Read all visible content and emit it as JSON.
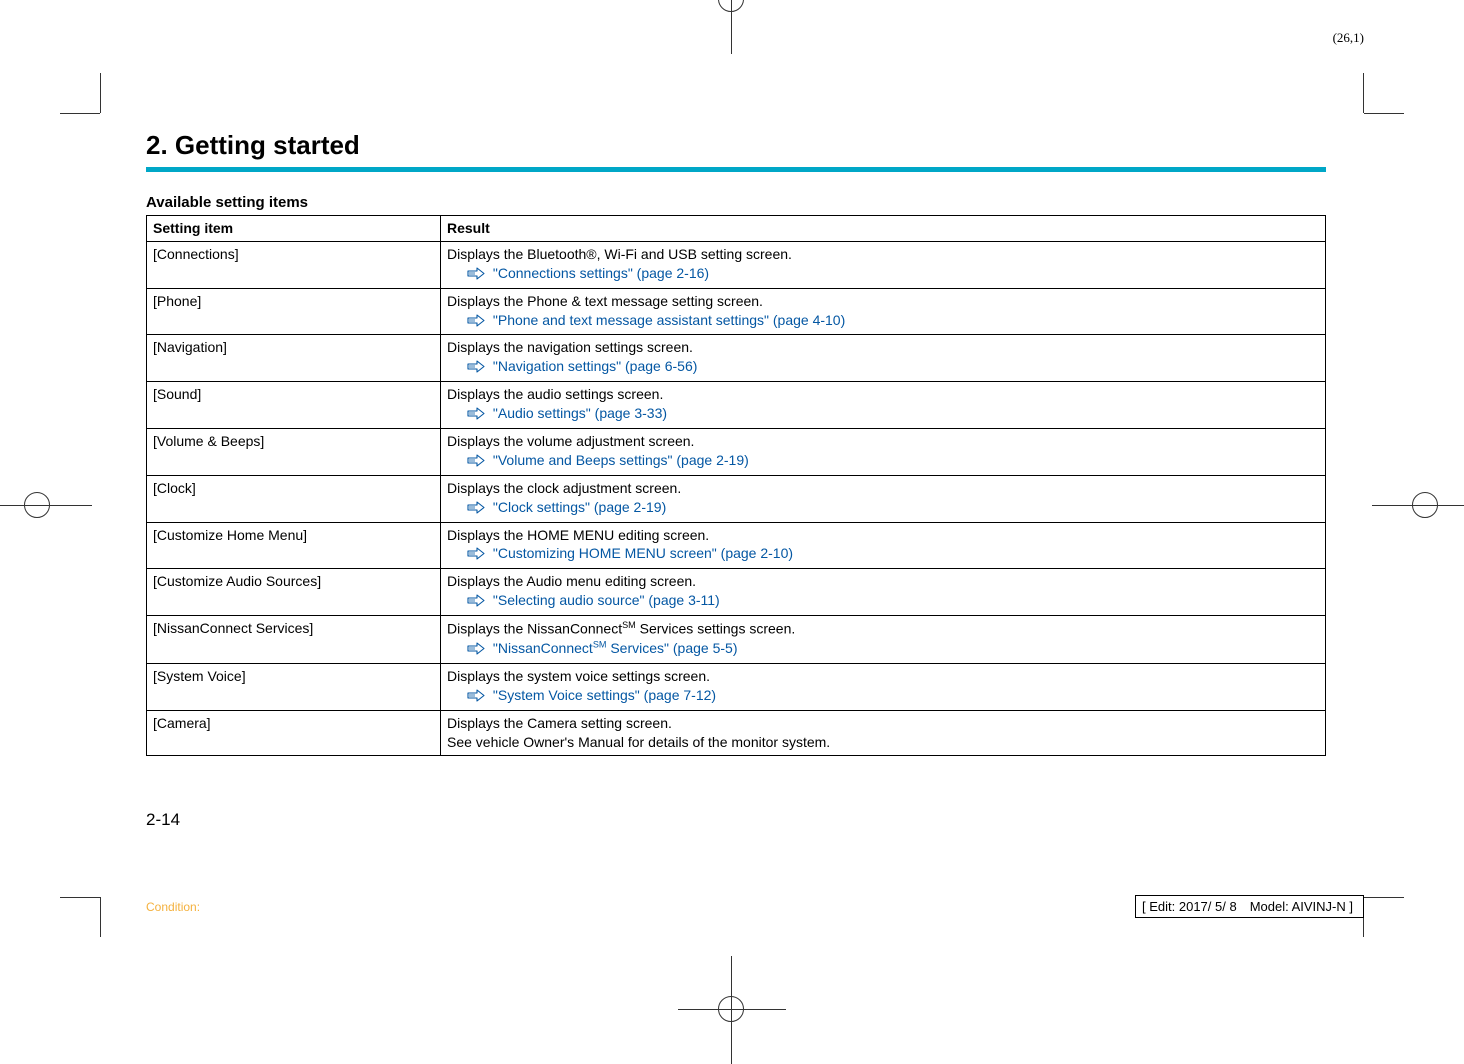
{
  "top_coord": "(26,1)",
  "chapter": "2. Getting started",
  "subtitle": "Available setting items",
  "table": {
    "headers": [
      "Setting item",
      "Result"
    ],
    "rows": [
      {
        "item": "[Connections]",
        "desc": "Displays the Bluetooth®, Wi-Fi and USB setting screen.",
        "link": "\"Connections settings\" (page 2-16)"
      },
      {
        "item": "[Phone]",
        "desc": "Displays the Phone & text message setting screen.",
        "link": "\"Phone and text message assistant settings\" (page 4-10)"
      },
      {
        "item": "[Navigation]",
        "desc": "Displays the navigation settings screen.",
        "link": "\"Navigation settings\" (page 6-56)"
      },
      {
        "item": "[Sound]",
        "desc": "Displays the audio settings screen.",
        "link": "\"Audio settings\" (page 3-33)"
      },
      {
        "item": "[Volume & Beeps]",
        "desc": "Displays the volume adjustment screen.",
        "link": "\"Volume and Beeps settings\" (page 2-19)"
      },
      {
        "item": "[Clock]",
        "desc": "Displays the clock adjustment screen.",
        "link": "\"Clock settings\" (page 2-19)"
      },
      {
        "item": "[Customize Home Menu]",
        "desc": "Displays the HOME MENU editing screen.",
        "link": "\"Customizing HOME MENU screen\" (page 2-10)"
      },
      {
        "item": "[Customize Audio Sources]",
        "desc": "Displays the Audio menu editing screen.",
        "link": "\"Selecting audio source\" (page 3-11)"
      },
      {
        "item": "[NissanConnect Services]",
        "desc_html": true,
        "desc": "Displays the NissanConnect<span class='sup'>SM</span> Services settings screen.",
        "link_html": true,
        "link": "\"NissanConnect<span class='sup'>SM</span> Services\" (page 5-5)"
      },
      {
        "item": "[System Voice]",
        "desc": "Displays the system voice settings screen.",
        "link": "\"System Voice settings\" (page 7-12)"
      },
      {
        "item": "[Camera]",
        "desc": "Displays the Camera setting screen.",
        "desc2": "See vehicle Owner's Manual for details of the monitor system.",
        "link": null
      }
    ]
  },
  "page_num": "2-14",
  "condition": "Condition:",
  "edit_box": "[ Edit: 2017/ 5/ 8 Model: AIVINJ-N ]",
  "hand_icon_svg": "<svg width='22' height='14' viewBox='0 0 22 14'><path d='M1 5 L7 5 L7 2 L14 7 L7 12 L7 9 L1 9 Z M3 6 L3 8 M5 6 L5 8' fill='none' stroke='#0457a3' stroke-width='1'/><path d='M2 6 L8 6 L8 3 L13 7 L8 11 L8 8 L2 8 Z' fill='none' stroke='#0457a3' stroke-width='0'/><g stroke='#0457a3' fill='none' stroke-width='1.2'><path d='M1 4 L9 4 L9 1 L15 6.5 L9 12 L9 9 L1 9 Z'/></g></svg>"
}
